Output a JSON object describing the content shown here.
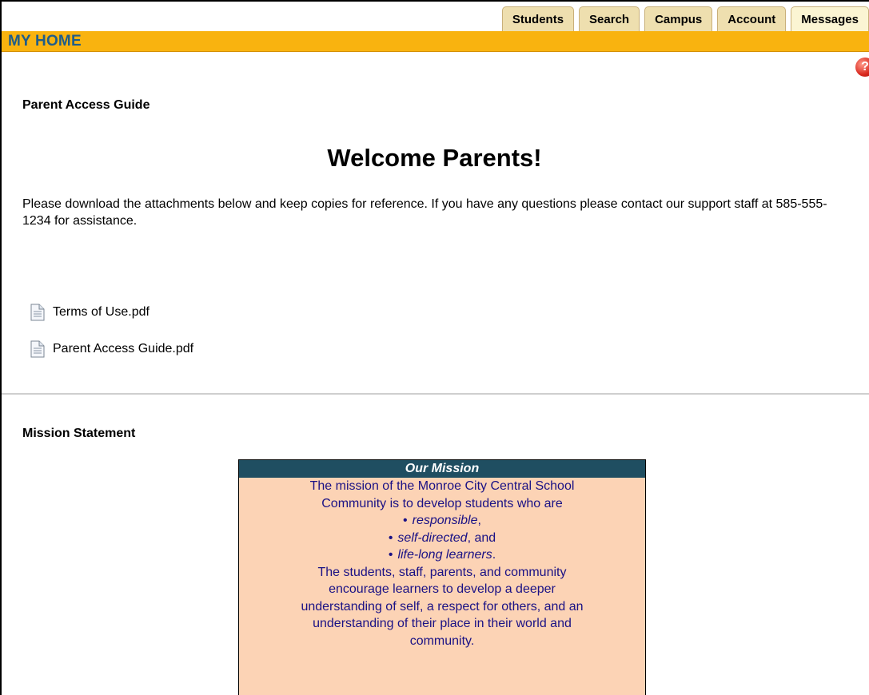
{
  "tabs": [
    "Students",
    "Search",
    "Campus",
    "Account",
    "Messages"
  ],
  "active_tab": "Messages",
  "header": {
    "title": "MY HOME"
  },
  "help": {
    "icon": "help-icon",
    "glyph": "?"
  },
  "guide": {
    "section_title": "Parent Access Guide",
    "welcome": "Welcome Parents!",
    "intro": "Please download the attachments below and keep copies for reference. If you have any questions please contact our support staff at 585-555-1234 for assistance.",
    "attachments": [
      {
        "icon": "document-icon",
        "name": "Terms of Use.pdf"
      },
      {
        "icon": "document-icon",
        "name": "Parent Access Guide.pdf"
      }
    ]
  },
  "mission": {
    "section_title": "Mission Statement",
    "box_title": "Our Mission",
    "line1": "The mission of the Monroe City Central School",
    "line2": "Community is to develop students who are",
    "bullets": [
      {
        "text": "responsible",
        "tail": ","
      },
      {
        "text": "self-directed",
        "tail": ", and"
      },
      {
        "text": "life-long learners",
        "tail": "."
      }
    ],
    "para2": [
      "The students, staff, parents, and community",
      "encourage learners to develop a deeper",
      "understanding of self, a respect for others, and an",
      "understanding of their place in their world and",
      "community."
    ]
  },
  "colors": {
    "home_bar": "#f9b30f",
    "home_title": "#1f5d8a",
    "mission_header": "#1f4e61",
    "mission_bg": "#fcd3b5",
    "mission_text": "#1a1185"
  }
}
